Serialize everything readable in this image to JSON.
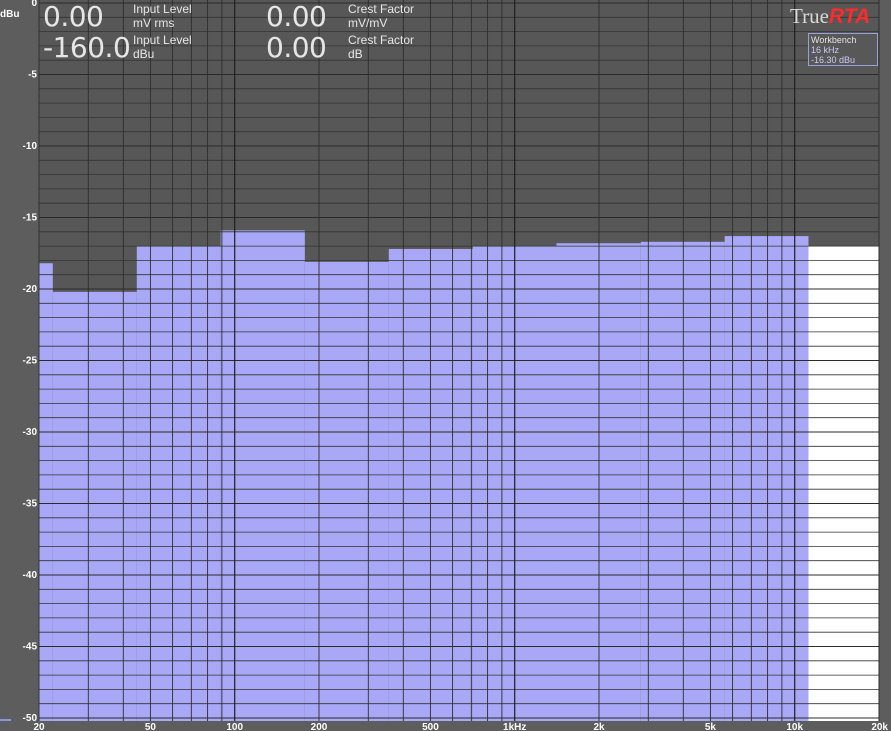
{
  "readouts": {
    "input_level_rms": {
      "value": "0.00",
      "label": "Input Level",
      "unit": "mV rms"
    },
    "input_level_dbu": {
      "value": "-160.0",
      "label": "Input Level",
      "unit": "dBu"
    },
    "crest_factor_ratio": {
      "value": "0.00",
      "label": "Crest Factor",
      "unit": "mV/mV"
    },
    "crest_factor_db": {
      "value": "0.00",
      "label": "Crest Factor",
      "unit": "dB"
    }
  },
  "logo": {
    "true": "True",
    "rta": "RTA"
  },
  "marker_box": {
    "title": "Workbench",
    "freq": "16 kHz",
    "level": "-16.30 dBu"
  },
  "colors": {
    "bar": "#a8a8f7",
    "plot_bg": "#575757",
    "window": "#5d5d5d",
    "white_band": "#ffffff",
    "accent": "#ff2b2b"
  },
  "chart_data": {
    "type": "bar",
    "title": "",
    "ylabel": "dBu",
    "xlabel": "",
    "x_scale": "log",
    "xlim": [
      20,
      20000
    ],
    "ylim": [
      -50,
      0
    ],
    "y_ticks": [
      0,
      -5,
      -10,
      -15,
      -20,
      -25,
      -30,
      -35,
      -40,
      -45,
      -50
    ],
    "y_tick_labels": [
      "0",
      "-5",
      "-10",
      "-15",
      "-20",
      "-25",
      "-30",
      "-35",
      "-40",
      "-45",
      "-50"
    ],
    "x_ticks": [
      20,
      50,
      100,
      200,
      500,
      1000,
      2000,
      5000,
      10000,
      20000
    ],
    "x_tick_labels": [
      "20",
      "50",
      "100",
      "200",
      "500",
      "1kHz",
      "2k",
      "5k",
      "10k",
      "20k"
    ],
    "grid": true,
    "bands": [
      {
        "lo": 20,
        "hi": 22.4,
        "value": -18.2
      },
      {
        "lo": 22.4,
        "hi": 44.7,
        "value": -20.2
      },
      {
        "lo": 44.7,
        "hi": 89.1,
        "value": -17.0
      },
      {
        "lo": 89.1,
        "hi": 178,
        "value": -15.9
      },
      {
        "lo": 178,
        "hi": 355,
        "value": -18.1
      },
      {
        "lo": 355,
        "hi": 708,
        "value": -17.2
      },
      {
        "lo": 708,
        "hi": 1410,
        "value": -17.0
      },
      {
        "lo": 1410,
        "hi": 2820,
        "value": -16.8
      },
      {
        "lo": 2820,
        "hi": 5620,
        "value": -16.7
      },
      {
        "lo": 5620,
        "hi": 11200,
        "value": -16.3
      },
      {
        "lo": 11200,
        "hi": 20000,
        "value": -17.0,
        "style": "white"
      }
    ]
  }
}
